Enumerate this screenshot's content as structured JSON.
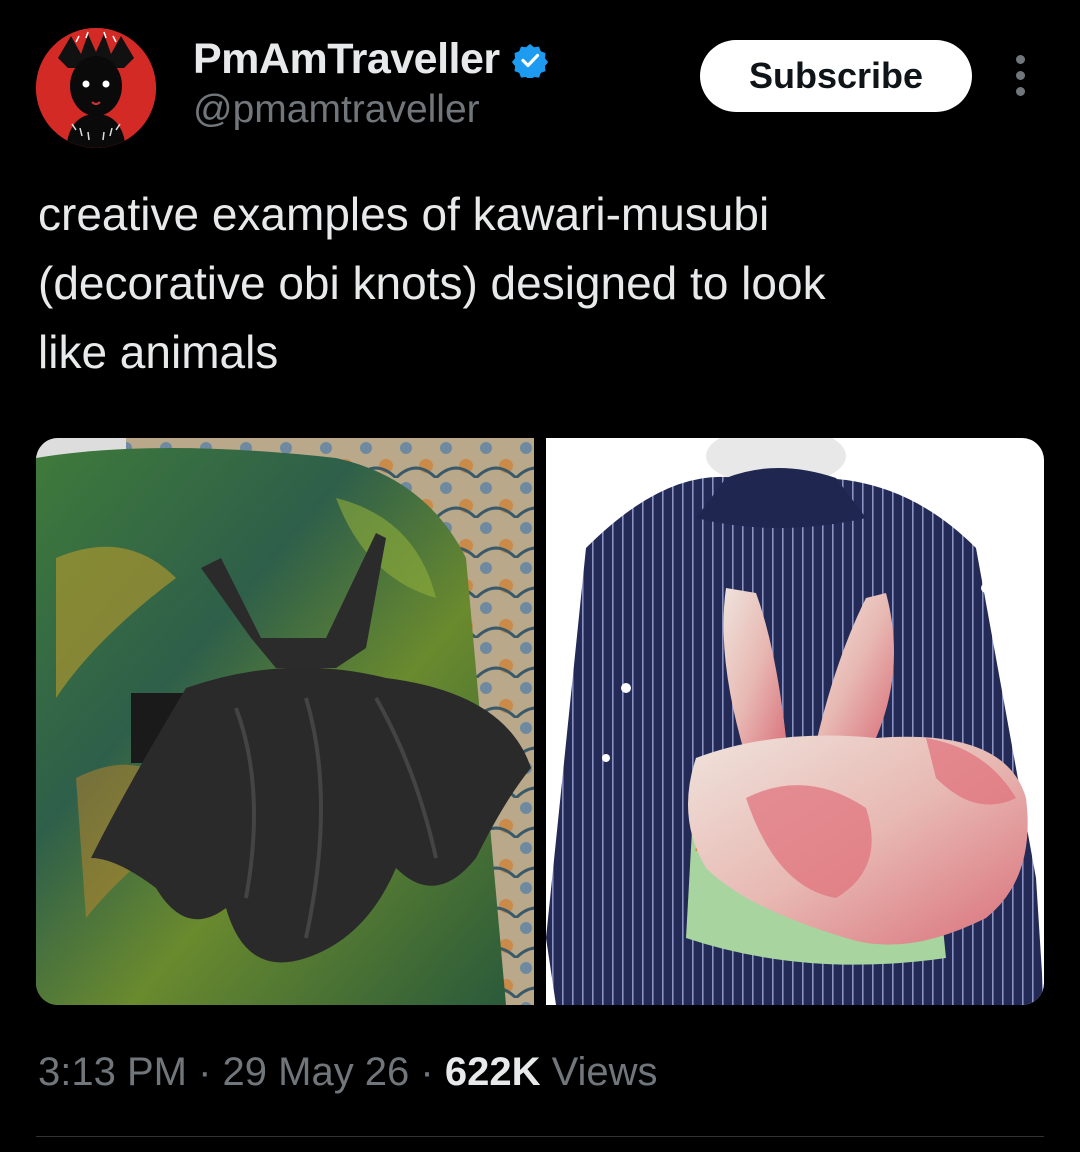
{
  "account": {
    "display_name": "PmAmTraveller",
    "handle": "@pmamtraveller",
    "verified": true,
    "avatar_icon": "demon-silhouette-avatar"
  },
  "actions": {
    "subscribe_label": "Subscribe",
    "more_icon": "vertical-ellipsis-icon"
  },
  "tweet": {
    "text": "creative examples of kawari-musubi\n(decorative obi knots) designed to look\nlike animals",
    "images": [
      {
        "name": "bat-obi-knot-photo",
        "description_icon": "bat-obi-image"
      },
      {
        "name": "rabbit-obi-knot-photo",
        "description_icon": "rabbit-obi-image"
      }
    ]
  },
  "meta": {
    "time": "3:13 PM",
    "separator": " · ",
    "date": "29 May 26",
    "views_count": "622K",
    "views_label": " Views"
  },
  "colors": {
    "background": "#000000",
    "text_primary": "#e7e9ea",
    "text_secondary": "#71767b",
    "verified_blue": "#1d9bf0",
    "avatar_red": "#d42a25"
  }
}
